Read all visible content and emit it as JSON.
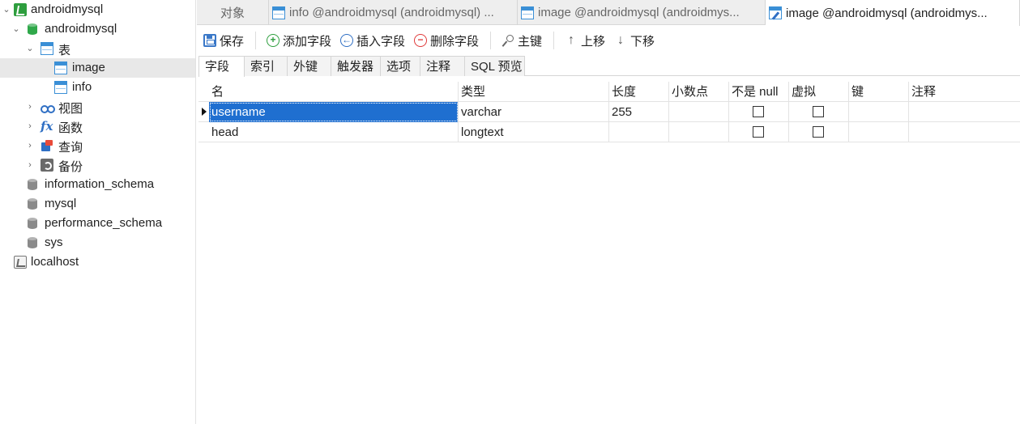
{
  "sidebar": {
    "connection": "androidmysql",
    "database": "androidmysql",
    "folders": {
      "tables": "表",
      "views": "视图",
      "functions": "函数",
      "queries": "查询",
      "backups": "备份"
    },
    "tables": [
      "image",
      "info"
    ],
    "other_databases": [
      "information_schema",
      "mysql",
      "performance_schema",
      "sys"
    ],
    "other_connection": "localhost"
  },
  "tabs": [
    {
      "label": "对象"
    },
    {
      "label": "info @androidmysql (androidmysql) ..."
    },
    {
      "label": "image @androidmysql (androidmys..."
    },
    {
      "label": "image @androidmysql (androidmys..."
    }
  ],
  "toolbar": {
    "save": "保存",
    "add_field": "添加字段",
    "insert_field": "插入字段",
    "delete_field": "删除字段",
    "primary_key": "主键",
    "move_up": "上移",
    "move_down": "下移"
  },
  "subtabs": [
    "字段",
    "索引",
    "外键",
    "触发器",
    "选项",
    "注释",
    "SQL 预览"
  ],
  "grid": {
    "columns": [
      "名",
      "类型",
      "长度",
      "小数点",
      "不是 null",
      "虚拟",
      "键",
      "注释"
    ],
    "rows": [
      {
        "name": "username",
        "type": "varchar",
        "length": "255",
        "decimals": "",
        "not_null": false,
        "virtual": false,
        "key": "",
        "comment": ""
      },
      {
        "name": "head",
        "type": "longtext",
        "length": "",
        "decimals": "",
        "not_null": false,
        "virtual": false,
        "key": "",
        "comment": ""
      }
    ]
  },
  "colors": {
    "selection": "#1f6fd0",
    "tree_selected": "#e8e8e8",
    "connection_green": "#2e9e3e",
    "table_blue": "#3a8fd6"
  }
}
